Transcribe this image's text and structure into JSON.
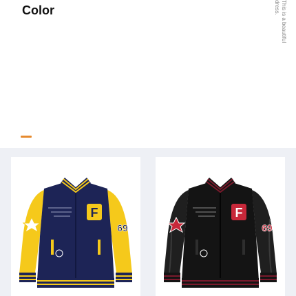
{
  "header": {
    "title": "Color",
    "side_note": "This is a beautiful dress."
  },
  "colors": {
    "accent": "#e68a2e",
    "background": "#eef0f5"
  },
  "products": [
    {
      "label": "Navy blue body with yellow sleeves",
      "body_color": "#1d2456",
      "sleeve_color": "#f5c91b",
      "stripe_color": "#f5c91b",
      "patch_text": "F",
      "sleeve_number": "69"
    },
    {
      "label": "Black body with black leather sleeves",
      "body_color": "#141414",
      "sleeve_color": "#1f1f1f",
      "stripe_color": "#7a1a2c",
      "patch_text": "F",
      "sleeve_number": "69"
    }
  ]
}
